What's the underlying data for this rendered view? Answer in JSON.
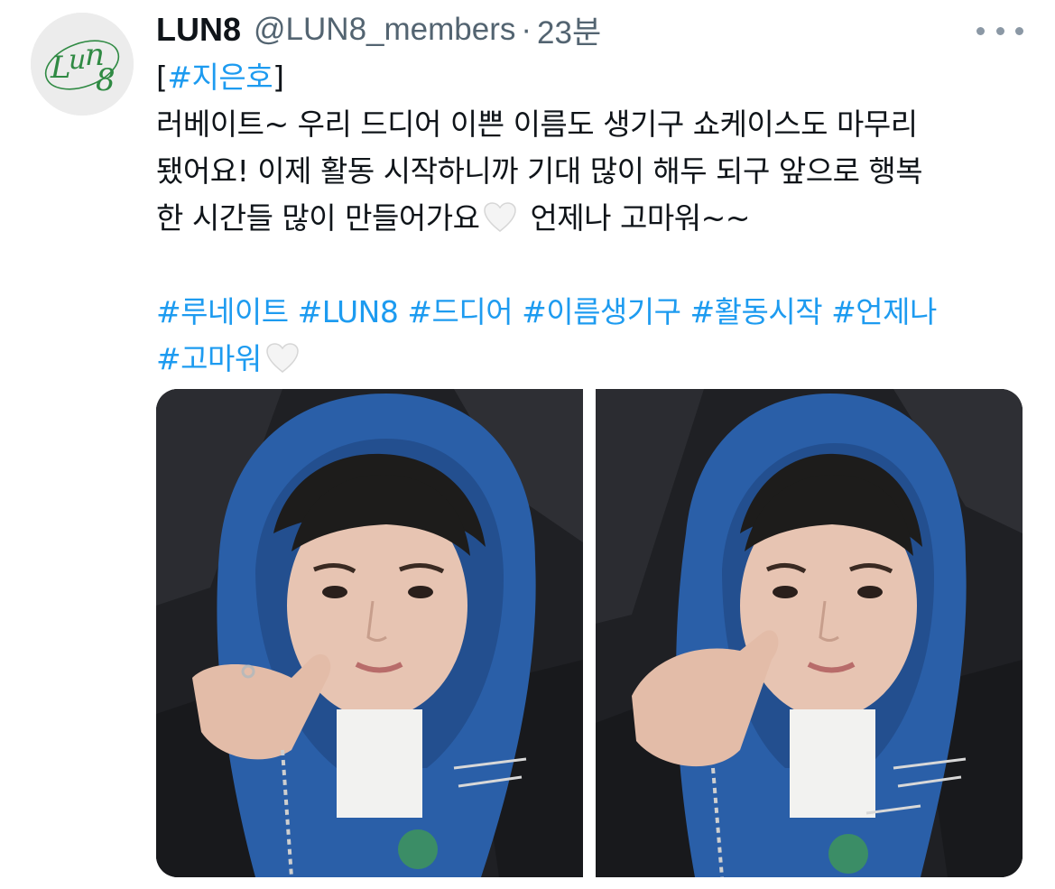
{
  "tweet": {
    "display_name": "LUN8",
    "handle": "@LUN8_members",
    "separator": "·",
    "time": "23분",
    "avatar_logo_icon": "lun8-logo",
    "more_icon": "more-options-icon",
    "line1_open": "[",
    "line1_tag": "#지은호",
    "line1_close": "]",
    "line2": "러베이트~ 우리 드디어 이쁜 이름도 생기구 쇼케이스도 마무리",
    "line3": "됐어요! 이제 활동 시작하니까 기대 많이 해두 되구 앞으로 행복",
    "line4_a": "한 시간들 많이 만들어가요",
    "line4_b": "언제나 고마워~~",
    "hashtags_line1": [
      "#루네이트",
      "#LUN8",
      "#드디어",
      "#이름생기구",
      "#활동시작",
      "#언제나"
    ],
    "hashtags_line2": [
      "#고마워"
    ],
    "heart_icon": "white-heart-emoji"
  },
  "colors": {
    "link": "#1d9bf0",
    "text": "#0f1419",
    "secondary": "#536471",
    "logo_green": "#2f8a43",
    "hoodie_blue": "#2a5fa8"
  },
  "media": {
    "count": 2,
    "items": [
      "selfie-photo",
      "selfie-photo"
    ]
  }
}
